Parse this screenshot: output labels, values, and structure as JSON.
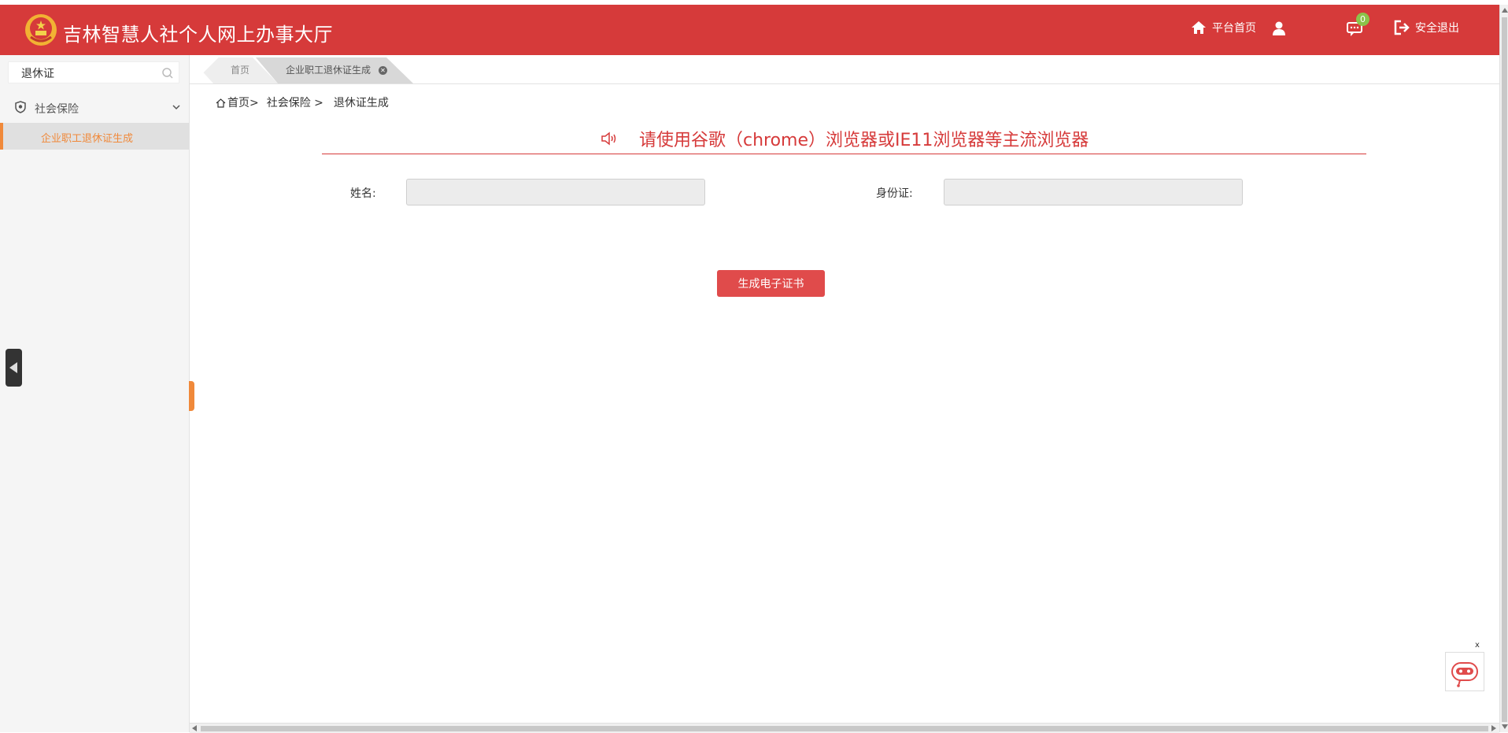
{
  "header": {
    "title": "吉林智慧人社个人网上办事大厅",
    "home_label": "平台首页",
    "message_count": "0",
    "logout_label": "安全退出",
    "bg_color": "#d63a3a"
  },
  "sidebar": {
    "search": {
      "value": "退休证"
    },
    "group": {
      "label": "社会保险",
      "icon": "shield-icon"
    },
    "items": [
      {
        "label": "企业职工退休证生成",
        "active": true
      }
    ]
  },
  "tabs": [
    {
      "label": "首页"
    },
    {
      "label": "企业职工退休证生成",
      "active": true
    }
  ],
  "breadcrumb": {
    "home": "首页>",
    "level1": "社会保险 >",
    "level2": "退休证生成"
  },
  "notice": "请使用谷歌（chrome）浏览器或IE11浏览器等主流浏览器",
  "form": {
    "name_label": "姓名:",
    "name_value": "",
    "id_label": "身份证:",
    "id_value": "",
    "submit_label": "生成电子证书"
  },
  "chatbot": {
    "close_label": "x"
  }
}
